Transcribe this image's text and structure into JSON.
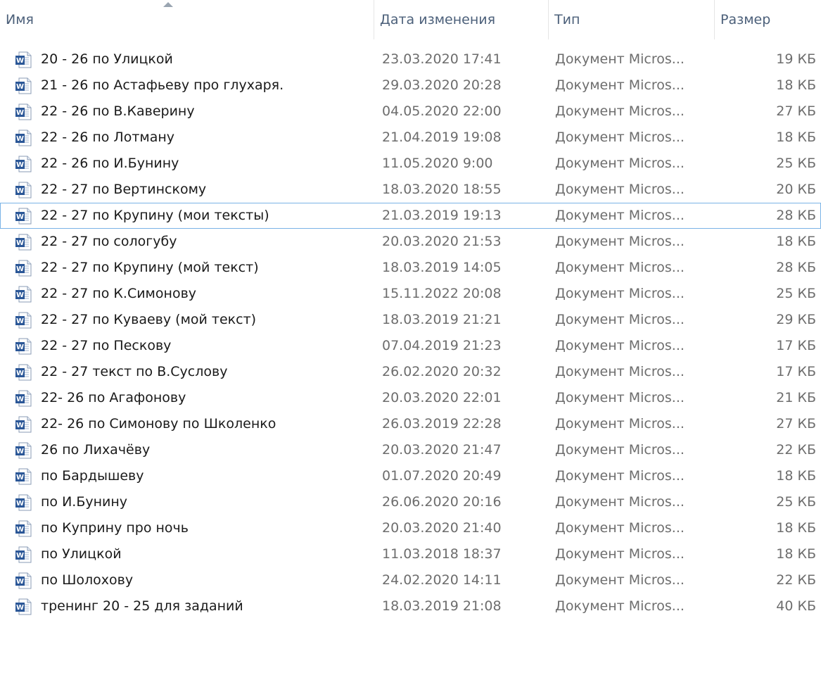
{
  "columns": {
    "name": "Имя",
    "date": "Дата изменения",
    "type": "Тип",
    "size": "Размер"
  },
  "icon": "word-document-icon",
  "accent_color": "#2b5797",
  "focus_color": "#7ab3e6",
  "files": [
    {
      "name": "20 - 26 по Улицкой",
      "date": "23.03.2020 17:41",
      "type": "Документ Micros...",
      "size": "19 КБ"
    },
    {
      "name": "21 - 26 по  Астафьеву про глухаря.",
      "date": "29.03.2020 20:28",
      "type": "Документ Micros...",
      "size": "18 КБ"
    },
    {
      "name": "22 - 26  по В.Каверину",
      "date": "04.05.2020 22:00",
      "type": "Документ Micros...",
      "size": "27 КБ"
    },
    {
      "name": "22 - 26  по Лотману",
      "date": "21.04.2019 19:08",
      "type": "Документ Micros...",
      "size": "18 КБ"
    },
    {
      "name": "22 - 26 по И.Бунину",
      "date": "11.05.2020 9:00",
      "type": "Документ Micros...",
      "size": "25 КБ"
    },
    {
      "name": "22 - 27  по Вертинскому",
      "date": "18.03.2020 18:55",
      "type": "Документ Micros...",
      "size": "20 КБ"
    },
    {
      "name": "22 - 27  по Крупину (мои тексты)",
      "date": "21.03.2019 19:13",
      "type": "Документ Micros...",
      "size": "28 КБ",
      "focused": true
    },
    {
      "name": "22 - 27  по сологубу",
      "date": "20.03.2020 21:53",
      "type": "Документ Micros...",
      "size": "18 КБ"
    },
    {
      "name": "22 - 27 по  Крупину (мой текст)",
      "date": "18.03.2019 14:05",
      "type": "Документ Micros...",
      "size": "28 КБ"
    },
    {
      "name": "22 - 27 по К.Симонову",
      "date": "15.11.2022 20:08",
      "type": "Документ Micros...",
      "size": "25 КБ"
    },
    {
      "name": "22 - 27 по Куваеву (мой текст)",
      "date": "18.03.2019 21:21",
      "type": "Документ Micros...",
      "size": "29 КБ"
    },
    {
      "name": "22 - 27 по Пескову",
      "date": "07.04.2019 21:23",
      "type": "Документ Micros...",
      "size": "17 КБ"
    },
    {
      "name": "22 - 27 текст по В.Суслову",
      "date": "26.02.2020 20:32",
      "type": "Документ Micros...",
      "size": "17 КБ"
    },
    {
      "name": "22- 26  по Агафонову",
      "date": "20.03.2020 22:01",
      "type": "Документ Micros...",
      "size": "21 КБ"
    },
    {
      "name": "22- 26 по Симонову по Школенко",
      "date": "26.03.2019 22:28",
      "type": "Документ Micros...",
      "size": "27 КБ"
    },
    {
      "name": "26 по Лихачёву",
      "date": "20.03.2020 21:47",
      "type": "Документ Micros...",
      "size": "22 КБ"
    },
    {
      "name": "по Бардышеву",
      "date": "01.07.2020 20:49",
      "type": "Документ Micros...",
      "size": "18 КБ"
    },
    {
      "name": "по И.Бунину",
      "date": "26.06.2020 20:16",
      "type": "Документ Micros...",
      "size": "25 КБ"
    },
    {
      "name": "по Куприну про ночь",
      "date": "20.03.2020 21:40",
      "type": "Документ Micros...",
      "size": "18 КБ"
    },
    {
      "name": "по Улицкой",
      "date": "11.03.2018 18:37",
      "type": "Документ Micros...",
      "size": "18 КБ"
    },
    {
      "name": "по Шолохову",
      "date": "24.02.2020 14:11",
      "type": "Документ Micros...",
      "size": "22 КБ"
    },
    {
      "name": "тренинг  20 - 25 для заданий",
      "date": "18.03.2019 21:08",
      "type": "Документ Micros...",
      "size": "40 КБ"
    }
  ]
}
